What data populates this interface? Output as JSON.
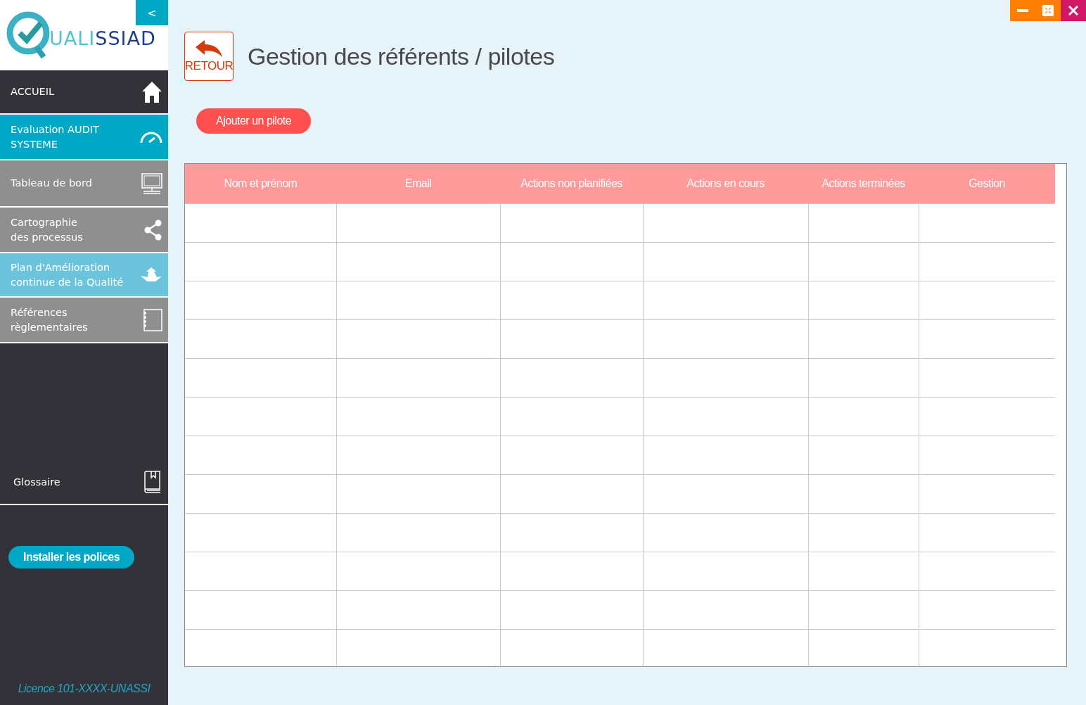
{
  "logo": {
    "text": "UALISSIAD"
  },
  "collapse_button": {
    "label": "<"
  },
  "nav": [
    {
      "label": "ACCUEIL",
      "kind": "home",
      "color": "#333238"
    },
    {
      "label": "Evaluation AUDIT SYSTEME",
      "kind": "gauge",
      "color": "#00a8c6"
    },
    {
      "label": "Tableau de bord",
      "kind": "monitor",
      "color": "#8f8f8f"
    },
    {
      "label": "Cartographie\ndes processus",
      "kind": "share",
      "color": "#8f8f8f"
    },
    {
      "label": "Plan d'Amélioration\ncontinue de la Qualité",
      "kind": "arrows",
      "color": "#6cc4dc"
    },
    {
      "label": "Références\nrèglementaires",
      "kind": "notebook",
      "color": "#8f8f8f"
    }
  ],
  "glossary": {
    "label": "Glossaire"
  },
  "install_fonts_button": {
    "label": "Installer les polices"
  },
  "licence": "Licence 101-XXXX-UNASSI",
  "back_button": {
    "label": "RETOUR"
  },
  "page_title": "Gestion des référents / pilotes",
  "add_button": {
    "label": "Ajouter un pilote"
  },
  "table": {
    "columns": [
      "Nom et prénom",
      "Email",
      "Actions non planifiées",
      "Actions en cours",
      "Actions terminées",
      "Gestion"
    ]
  }
}
